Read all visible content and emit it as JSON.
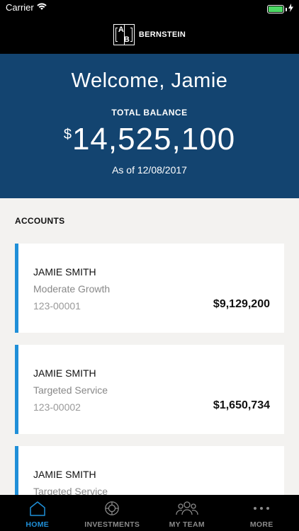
{
  "status_bar": {
    "carrier": "Carrier",
    "time": "",
    "battery_level": 1.0
  },
  "brand": {
    "logo_letters": [
      "A",
      "B"
    ],
    "name": "BERNSTEIN"
  },
  "hero": {
    "welcome": "Welcome, Jamie",
    "total_label": "TOTAL BALANCE",
    "currency_symbol": "$",
    "balance": "14,525,100",
    "as_of": "As of 12/08/2017"
  },
  "accounts": {
    "section_title": "ACCOUNTS",
    "items": [
      {
        "name": "JAMIE SMITH",
        "type": "Moderate Growth",
        "number": "123-00001",
        "value": "$9,129,200"
      },
      {
        "name": "JAMIE SMITH",
        "type": "Targeted Service",
        "number": "123-00002",
        "value": "$1,650,734"
      },
      {
        "name": "JAMIE SMITH",
        "type": "Targeted Service",
        "number": "",
        "value": ""
      }
    ]
  },
  "tab_bar": {
    "tabs": [
      {
        "label": "HOME",
        "icon": "home-icon",
        "active": true
      },
      {
        "label": "INVESTMENTS",
        "icon": "investments-icon",
        "active": false
      },
      {
        "label": "MY TEAM",
        "icon": "team-icon",
        "active": false
      },
      {
        "label": "MORE",
        "icon": "more-icon",
        "active": false
      }
    ]
  },
  "colors": {
    "accent": "#1f8fd8",
    "hero_bg": "#134470",
    "battery": "#4cd964"
  }
}
